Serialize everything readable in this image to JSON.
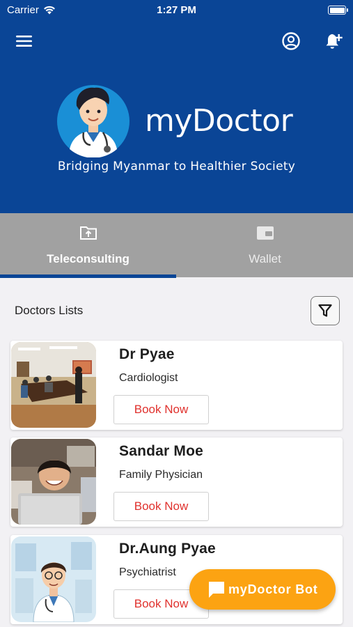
{
  "status_bar": {
    "carrier": "Carrier",
    "time": "1:27 PM",
    "battery_level": 1.0
  },
  "header": {
    "menu_icon": "hamburger-menu-icon",
    "profile_icon": "user-circle-icon",
    "notification_icon": "bell-plus-icon",
    "brand_name": "myDoctor",
    "tagline": "Bridging Myanmar to Healthier Society",
    "background_color": "#0a4596"
  },
  "tabs": [
    {
      "label": "Teleconsulting",
      "icon": "folder-upload-icon",
      "active": true
    },
    {
      "label": "Wallet",
      "icon": "wallet-icon",
      "active": false
    }
  ],
  "list": {
    "title": "Doctors Lists",
    "filter_icon": "filter-funnel-icon"
  },
  "doctors": [
    {
      "name": "Dr Pyae",
      "specialty": "Cardiologist",
      "button_label": "Book Now"
    },
    {
      "name": "Sandar Moe",
      "specialty": "Family Physician",
      "button_label": "Book Now"
    },
    {
      "name": "Dr.Aung Pyae",
      "specialty": "Psychiatrist",
      "button_label": "Book Now"
    }
  ],
  "bot_button": {
    "label": "myDoctor Bot",
    "icon": "chat-bubble-icon",
    "color": "#fca312"
  },
  "accent_color": "#e0312d"
}
